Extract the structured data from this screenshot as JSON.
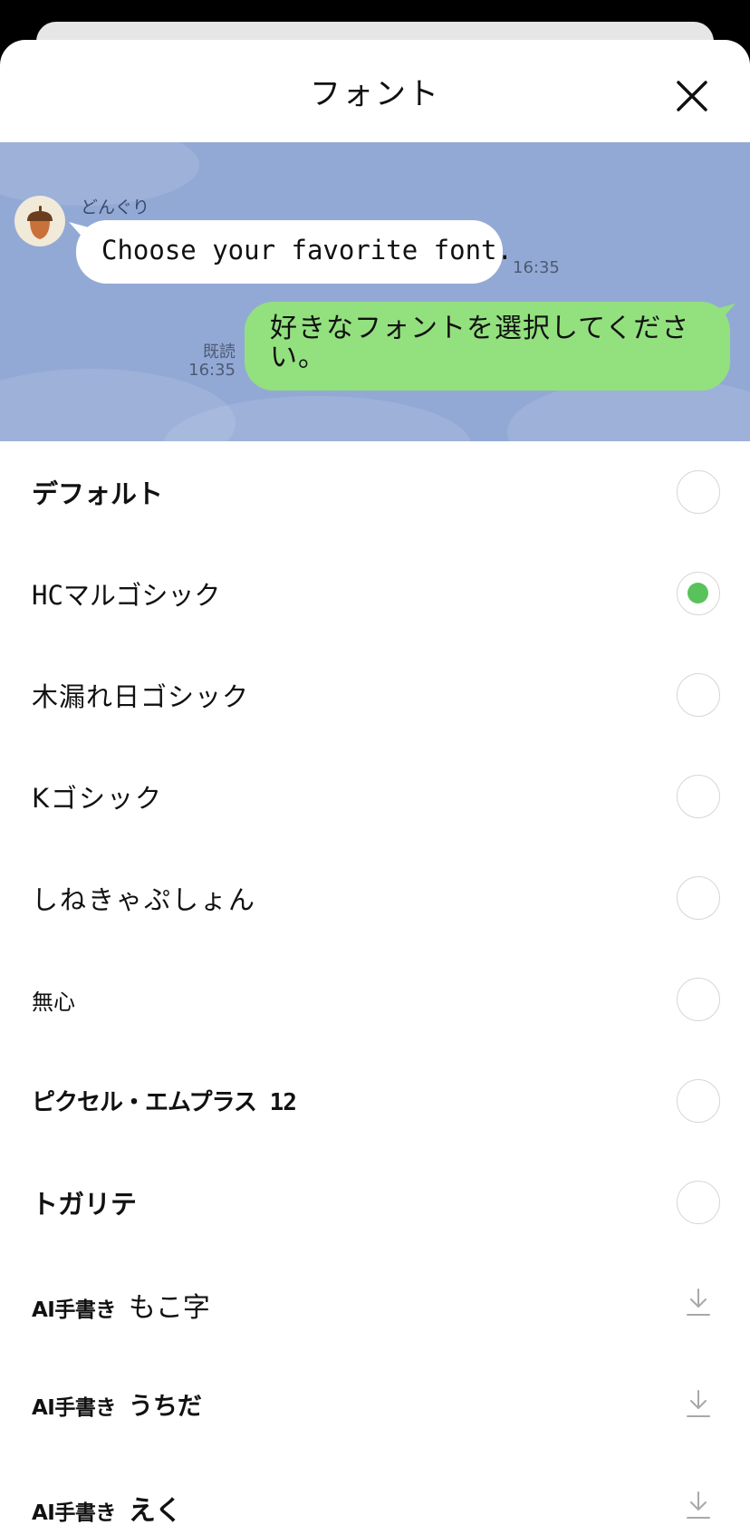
{
  "sheet": {
    "title": "フォント"
  },
  "preview": {
    "sender_name": "どんぐり",
    "incoming_message": "Choose your favorite font.",
    "incoming_time": "16:35",
    "read_label": "既読",
    "outgoing_time": "16:35",
    "outgoing_message": "好きなフォントを選択してください。"
  },
  "fonts": [
    {
      "label": "デフォルト",
      "control": "radio",
      "selected": false
    },
    {
      "label": "HCマルゴシック",
      "control": "radio",
      "selected": true
    },
    {
      "label": "木漏れ日ゴシック",
      "control": "radio",
      "selected": false
    },
    {
      "label": "Kゴシック",
      "control": "radio",
      "selected": false
    },
    {
      "label": "しねきゃぷしょん",
      "control": "radio",
      "selected": false
    },
    {
      "label": "無心",
      "control": "radio",
      "selected": false
    },
    {
      "label": "ピクセル・エムプラス 12",
      "control": "radio",
      "selected": false
    },
    {
      "label": "トガリテ",
      "control": "radio",
      "selected": false
    },
    {
      "tag": "AI手書き",
      "label": "もこ字",
      "control": "download"
    },
    {
      "tag": "AI手書き",
      "label": "うちだ",
      "control": "download"
    },
    {
      "tag": "AI手書き",
      "label": "えく",
      "control": "download"
    }
  ],
  "colors": {
    "preview_bg": "#93a9d5",
    "outgoing_bubble": "#93e07f",
    "selected_radio": "#5ac25a"
  },
  "icons": {
    "close": "close-icon",
    "avatar": "acorn-icon",
    "download": "download-icon"
  }
}
